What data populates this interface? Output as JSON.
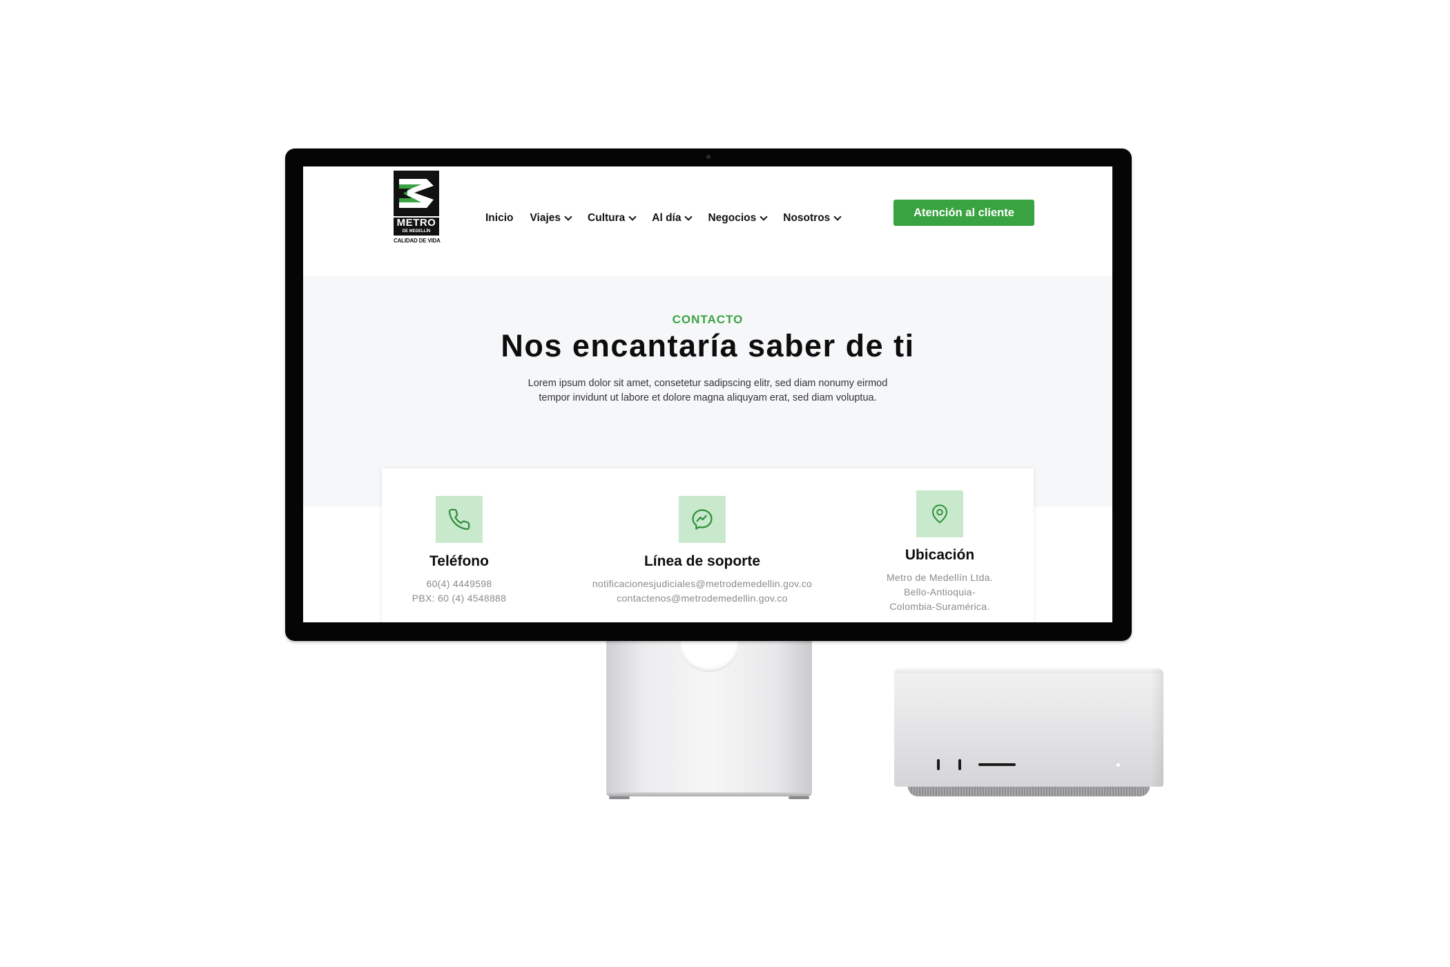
{
  "site": {
    "logo": {
      "wordmark": "METRO",
      "sub": "DE MEDELLÍN",
      "tagline": "CALIDAD DE VIDA"
    },
    "nav": [
      {
        "label": "Inicio",
        "has_dropdown": false
      },
      {
        "label": "Viajes",
        "has_dropdown": true
      },
      {
        "label": "Cultura",
        "has_dropdown": true
      },
      {
        "label": "Al día",
        "has_dropdown": true
      },
      {
        "label": "Negocios",
        "has_dropdown": true
      },
      {
        "label": "Nosotros",
        "has_dropdown": true
      }
    ],
    "cta_label": "Atención al cliente"
  },
  "hero": {
    "eyebrow": "CONTACTO",
    "title": "Nos encantaría saber de ti",
    "description_line1": "Lorem ipsum dolor sit amet, consetetur sadipscing elitr, sed diam nonumy eirmod",
    "description_line2": "tempor invidunt ut labore et dolore magna aliquyam erat, sed diam voluptua."
  },
  "contacts": [
    {
      "icon": "phone-icon",
      "title": "Teléfono",
      "lines": [
        "60(4) 4449598",
        "PBX: 60 (4) 4548888"
      ]
    },
    {
      "icon": "messenger-icon",
      "title": "Línea de soporte",
      "lines": [
        "notificacionesjudiciales@metrodemedellin.gov.co",
        "contactenos@metrodemedellin.gov.co"
      ]
    },
    {
      "icon": "location-pin-icon",
      "title": "Ubicación",
      "lines": [
        "Metro de Medellín Ltda.",
        "Bello-Antioquia-",
        "Colombia-Suramérica."
      ]
    }
  ],
  "colors": {
    "accent_green": "#3aa341",
    "icon_tile": "#c8e9cc",
    "hero_bg": "#f6f7f9",
    "text_dark": "#0d0d0d",
    "text_muted": "#8a8a8a"
  }
}
